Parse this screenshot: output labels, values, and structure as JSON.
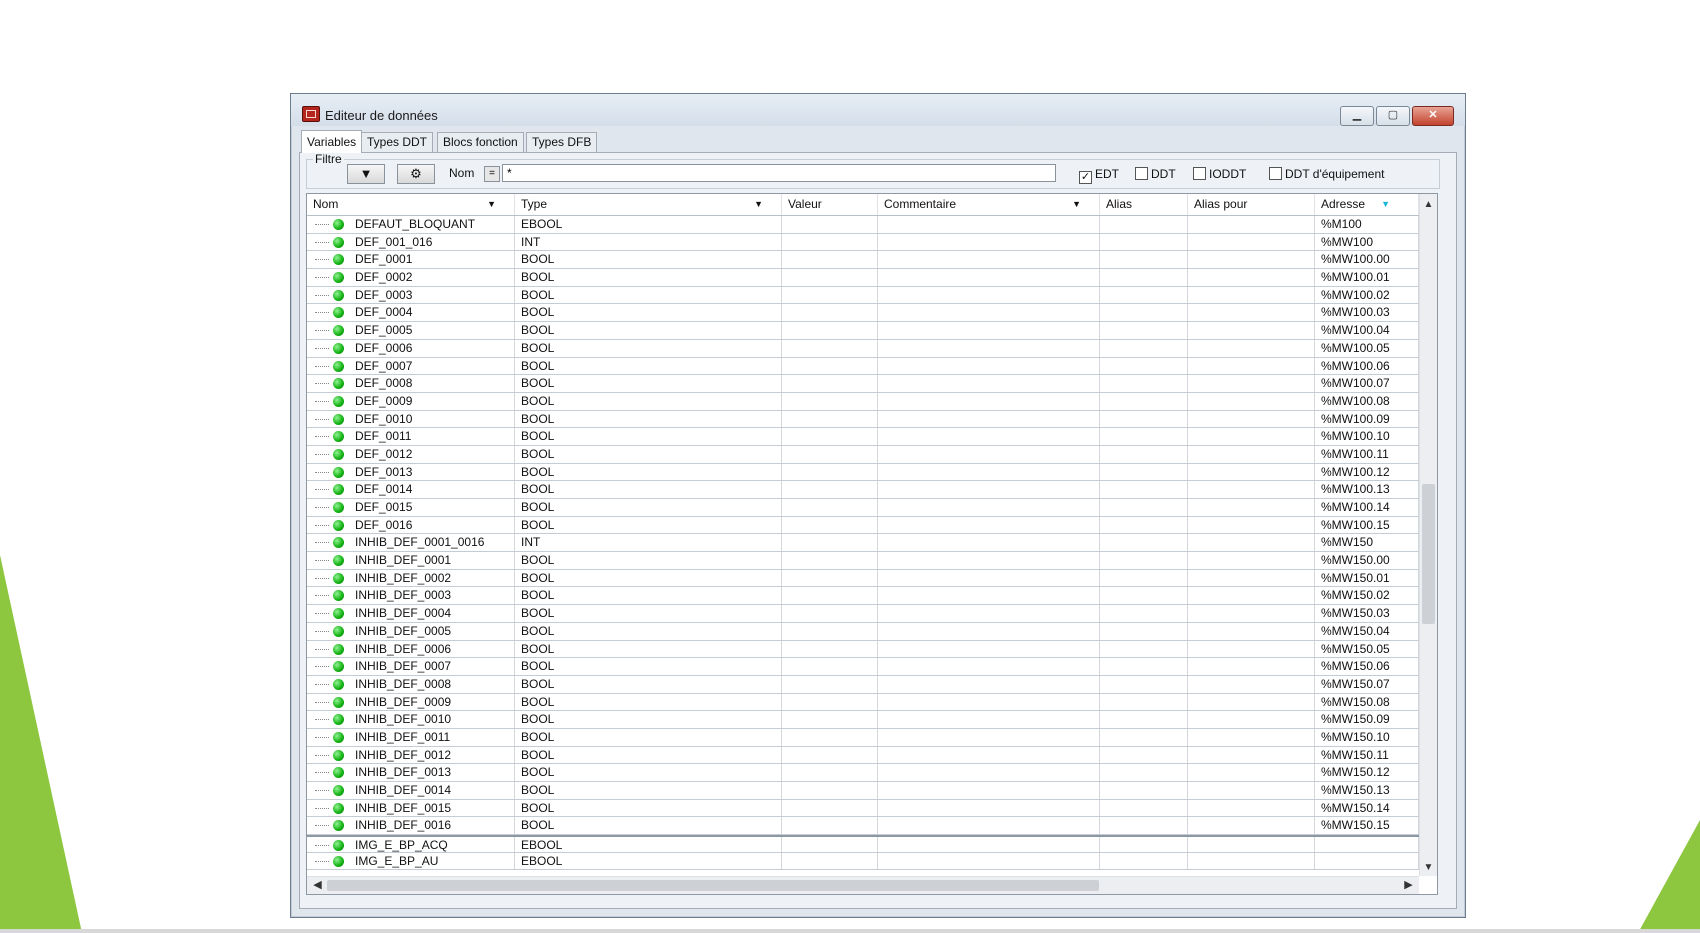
{
  "window": {
    "title": "Editeur de données"
  },
  "tabs": [
    "Variables",
    "Types DDT",
    "Blocs fonction",
    "Types DFB"
  ],
  "filter": {
    "legend": "Filtre",
    "nom_label": "Nom",
    "eq_label": "=",
    "name_value": "*",
    "checkboxes": [
      {
        "label": "EDT",
        "checked": true
      },
      {
        "label": "DDT",
        "checked": false
      },
      {
        "label": "IODDT",
        "checked": false
      },
      {
        "label": "DDT d'équipement",
        "checked": false
      }
    ]
  },
  "columns": [
    "Nom",
    "Type",
    "Valeur",
    "Commentaire",
    "Alias",
    "Alias pour",
    "Adresse"
  ],
  "rows": [
    {
      "nom": "DEFAUT_BLOQUANT",
      "type": "EBOOL",
      "adresse": "%M100"
    },
    {
      "nom": "DEF_001_016",
      "type": "INT",
      "adresse": "%MW100"
    },
    {
      "nom": "DEF_0001",
      "type": "BOOL",
      "adresse": "%MW100.00"
    },
    {
      "nom": "DEF_0002",
      "type": "BOOL",
      "adresse": "%MW100.01"
    },
    {
      "nom": "DEF_0003",
      "type": "BOOL",
      "adresse": "%MW100.02"
    },
    {
      "nom": "DEF_0004",
      "type": "BOOL",
      "adresse": "%MW100.03"
    },
    {
      "nom": "DEF_0005",
      "type": "BOOL",
      "adresse": "%MW100.04"
    },
    {
      "nom": "DEF_0006",
      "type": "BOOL",
      "adresse": "%MW100.05"
    },
    {
      "nom": "DEF_0007",
      "type": "BOOL",
      "adresse": "%MW100.06"
    },
    {
      "nom": "DEF_0008",
      "type": "BOOL",
      "adresse": "%MW100.07"
    },
    {
      "nom": "DEF_0009",
      "type": "BOOL",
      "adresse": "%MW100.08"
    },
    {
      "nom": "DEF_0010",
      "type": "BOOL",
      "adresse": "%MW100.09"
    },
    {
      "nom": "DEF_0011",
      "type": "BOOL",
      "adresse": "%MW100.10"
    },
    {
      "nom": "DEF_0012",
      "type": "BOOL",
      "adresse": "%MW100.11"
    },
    {
      "nom": "DEF_0013",
      "type": "BOOL",
      "adresse": "%MW100.12"
    },
    {
      "nom": "DEF_0014",
      "type": "BOOL",
      "adresse": "%MW100.13"
    },
    {
      "nom": "DEF_0015",
      "type": "BOOL",
      "adresse": "%MW100.14"
    },
    {
      "nom": "DEF_0016",
      "type": "BOOL",
      "adresse": "%MW100.15"
    },
    {
      "nom": "INHIB_DEF_0001_0016",
      "type": "INT",
      "adresse": "%MW150"
    },
    {
      "nom": "INHIB_DEF_0001",
      "type": "BOOL",
      "adresse": "%MW150.00"
    },
    {
      "nom": "INHIB_DEF_0002",
      "type": "BOOL",
      "adresse": "%MW150.01"
    },
    {
      "nom": "INHIB_DEF_0003",
      "type": "BOOL",
      "adresse": "%MW150.02"
    },
    {
      "nom": "INHIB_DEF_0004",
      "type": "BOOL",
      "adresse": "%MW150.03"
    },
    {
      "nom": "INHIB_DEF_0005",
      "type": "BOOL",
      "adresse": "%MW150.04"
    },
    {
      "nom": "INHIB_DEF_0006",
      "type": "BOOL",
      "adresse": "%MW150.05"
    },
    {
      "nom": "INHIB_DEF_0007",
      "type": "BOOL",
      "adresse": "%MW150.06"
    },
    {
      "nom": "INHIB_DEF_0008",
      "type": "BOOL",
      "adresse": "%MW150.07"
    },
    {
      "nom": "INHIB_DEF_0009",
      "type": "BOOL",
      "adresse": "%MW150.08"
    },
    {
      "nom": "INHIB_DEF_0010",
      "type": "BOOL",
      "adresse": "%MW150.09"
    },
    {
      "nom": "INHIB_DEF_0011",
      "type": "BOOL",
      "adresse": "%MW150.10"
    },
    {
      "nom": "INHIB_DEF_0012",
      "type": "BOOL",
      "adresse": "%MW150.11"
    },
    {
      "nom": "INHIB_DEF_0013",
      "type": "BOOL",
      "adresse": "%MW150.12"
    },
    {
      "nom": "INHIB_DEF_0014",
      "type": "BOOL",
      "adresse": "%MW150.13"
    },
    {
      "nom": "INHIB_DEF_0015",
      "type": "BOOL",
      "adresse": "%MW150.14"
    },
    {
      "nom": "INHIB_DEF_0016",
      "type": "BOOL",
      "adresse": "%MW150.15"
    },
    {
      "nom": "IMG_E_BP_ACQ",
      "type": "EBOOL",
      "adresse": ""
    },
    {
      "nom": "IMG_E_BP_AU",
      "type": "EBOOL",
      "adresse": ""
    }
  ],
  "colors": {
    "status_dot": "#10b010",
    "decor_green": "#8dc63f"
  },
  "icons": {
    "filter_apply": "funnel-icon",
    "filter_config": "gears-icon",
    "status": "green-dot-icon"
  }
}
